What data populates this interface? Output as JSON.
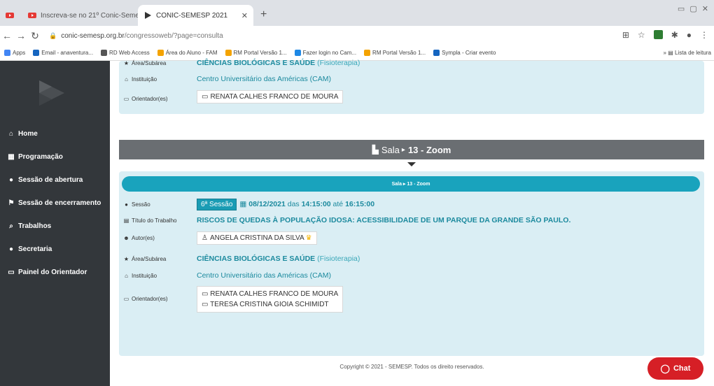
{
  "browser": {
    "tabs": [
      {
        "title": "Inscreva-se no 21º Conic-Semes",
        "active": false
      },
      {
        "title": "CONIC-SEMESP 2021",
        "active": true
      }
    ],
    "new_tab_label": "+",
    "url_host": "conic-semesp.org.br",
    "url_path": "/congressoweb/?page=consulta",
    "bookmarks": [
      {
        "label": "Apps",
        "color": "#4285f4"
      },
      {
        "label": "Email - anaventura...",
        "color": "#1565c0"
      },
      {
        "label": "RD Web Access",
        "color": "#555555"
      },
      {
        "label": "Área do Aluno - FAM",
        "color": "#f4a300"
      },
      {
        "label": "RM Portal Versão 1...",
        "color": "#f4a300"
      },
      {
        "label": "Fazer login no Cam...",
        "color": "#1e88e5"
      },
      {
        "label": "RM Portal Versão 1...",
        "color": "#f4a300"
      },
      {
        "label": "Sympla - Criar evento",
        "color": "#1565c0"
      }
    ],
    "reading_list": "Lista de leitura"
  },
  "sidebar": {
    "items": [
      {
        "label": "Home",
        "icon": "home-icon",
        "glyph": "⌂"
      },
      {
        "label": "Programação",
        "icon": "calendar-icon",
        "glyph": "▦"
      },
      {
        "label": "Sessão de abertura",
        "icon": "circle-icon",
        "glyph": "●"
      },
      {
        "label": "Sessão de encerramento",
        "icon": "flag-icon",
        "glyph": "⚑"
      },
      {
        "label": "Trabalhos",
        "icon": "search-icon",
        "glyph": "⌕"
      },
      {
        "label": "Secretaria",
        "icon": "info-icon",
        "glyph": "●"
      },
      {
        "label": "Painel do Orientador",
        "icon": "presenter-icon",
        "glyph": "▭"
      }
    ]
  },
  "top_card": {
    "area_label": "Área/Subárea",
    "area_value": "CIÊNCIAS BIOLÓGICAS E SAÚDE",
    "area_sub": "(Fisioterapia)",
    "inst_label": "Instituição",
    "inst_value": "Centro Universitário das Américas (CAM)",
    "orient_label": "Orientador(es)",
    "orient_values": [
      "RENATA CALHES FRANCO DE MOURA"
    ]
  },
  "sala": {
    "prefix": "Sala",
    "name": "13 - Zoom",
    "pill_text": "Sala ▸ 13 - Zoom"
  },
  "session_card": {
    "sessao_label": "Sessão",
    "sessao_badge": "6ª Sessão",
    "date": "08/12/2021",
    "das": "das",
    "start": "14:15:00",
    "ate": "até",
    "end": "16:15:00",
    "titulo_label": "Título do Trabalho",
    "titulo_value": "RISCOS DE QUEDAS À POPULAÇÃO IDOSA: ACESSIBILIDADE DE UM PARQUE DA GRANDE SÃO PAULO.",
    "autor_label": "Autor(es)",
    "autor_value": "ANGELA CRISTINA DA SILVA",
    "area_label": "Área/Subárea",
    "area_value": "CIÊNCIAS BIOLÓGICAS E SAÚDE",
    "area_sub": "(Fisioterapia)",
    "inst_label": "Instituição",
    "inst_value": "Centro Universitário das Américas (CAM)",
    "orient_label": "Orientador(es)",
    "orient_values": [
      "RENATA CALHES FRANCO DE MOURA",
      "TERESA CRISTINA GIOIA SCHIMIDT"
    ]
  },
  "footer": {
    "copyright": "Copyright © 2021 - SEMESP. Todos os direito reservados.",
    "chat_label": "Chat"
  },
  "colors": {
    "sidebar_bg": "#33373b",
    "card_bg": "#daeef4",
    "accent": "#1c8a9e",
    "chat": "#d61f26"
  }
}
